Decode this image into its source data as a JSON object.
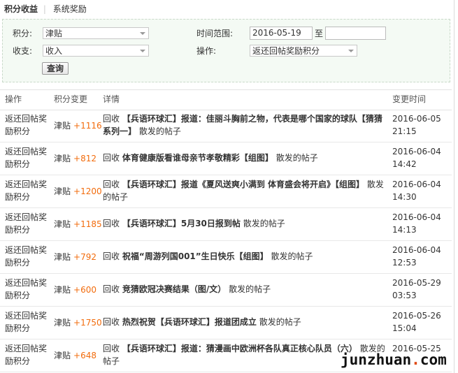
{
  "tabs": {
    "active": "积分收益",
    "other": "系统奖励"
  },
  "filter": {
    "credit_label": "积分:",
    "credit_value": "津贴",
    "flow_label": "收支:",
    "flow_value": "收入",
    "range_label": "时间范围:",
    "range_start": "2016-05-19",
    "range_sep": "至",
    "range_end": "",
    "op_label": "操作:",
    "op_value": "返还回帖奖励积分",
    "search_label": "查询"
  },
  "table": {
    "headers": {
      "op": "操作",
      "change": "积分变更",
      "detail": "详情",
      "time": "变更时间"
    },
    "rows": [
      {
        "op": "返还回帖奖励积分",
        "credit": "津贴",
        "amount": "+1116",
        "prefix": "回收",
        "title": "【兵语环球汇】报道：佳丽斗胸前之物，代表是哪个国家的球队【猜猜系列一】",
        "suffix": "散发的帖子",
        "date": "2016-06-05",
        "clock": "21:15"
      },
      {
        "op": "返还回帖奖励积分",
        "credit": "津贴",
        "amount": "+812",
        "prefix": "回收",
        "title": "体育健康版看谁母亲节孝敬精彩【组图】",
        "suffix": "散发的帖子",
        "date": "2016-06-04",
        "clock": "14:42"
      },
      {
        "op": "返还回帖奖励积分",
        "credit": "津贴",
        "amount": "+1200",
        "prefix": "回收",
        "title": "【兵语环球汇】报道《夏风送爽小满到 体育盛会将开启》【组图】",
        "suffix": "散发的帖子",
        "date": "2016-06-04",
        "clock": "14:30"
      },
      {
        "op": "返还回帖奖励积分",
        "credit": "津贴",
        "amount": "+1185",
        "prefix": "回收",
        "title": "【兵语环球汇】5月30日报到帖",
        "suffix": "散发的帖子",
        "date": "2016-06-04",
        "clock": "14:13"
      },
      {
        "op": "返还回帖奖励积分",
        "credit": "津贴",
        "amount": "+792",
        "prefix": "回收",
        "title": "祝福“周游列国001”生日快乐【组图】",
        "suffix": "散发的帖子",
        "date": "2016-06-04",
        "clock": "12:53"
      },
      {
        "op": "返还回帖奖励积分",
        "credit": "津贴",
        "amount": "+600",
        "prefix": "回收",
        "title": "竞猜欧冠决赛结果（图/文）",
        "suffix": "散发的帖子",
        "date": "2016-05-29",
        "clock": "03:53"
      },
      {
        "op": "返还回帖奖励积分",
        "credit": "津贴",
        "amount": "+1750",
        "prefix": "回收",
        "title": "热烈祝贺【兵语环球汇】报道团成立",
        "suffix": "散发的帖子",
        "date": "2016-05-26",
        "clock": "15:04"
      },
      {
        "op": "返还回帖奖励积分",
        "credit": "津贴",
        "amount": "+648",
        "prefix": "回收",
        "title": "【兵语环球汇】报道：猜漫画中欧洲杯各队真正核心队员（六）",
        "suffix": "散发的帖子",
        "date": "2016-05-25",
        "clock": ""
      }
    ]
  },
  "watermark": {
    "pre": "junzhuan",
    "dot": ".",
    "post": "com"
  },
  "colors": {
    "amount": "#f26c0d",
    "filter_bg": "#f4faf4",
    "filter_border": "#c9d9c9"
  }
}
